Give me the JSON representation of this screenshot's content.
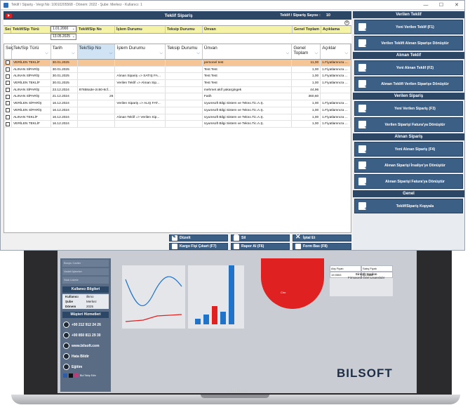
{
  "window": {
    "title": "Teklif / Sipariş - Vergi No: 10010205568 - Dönem: 2022 - Şube: Merkez - Kullanıcı: 1",
    "controls": [
      "—",
      "☐",
      "✕"
    ]
  },
  "header": {
    "title": "Teklif Sipariş",
    "count_label": "Teklif / Sipariş Sayısı :",
    "count_value": "10"
  },
  "filters": {
    "labels": [
      "Seç",
      "Teklif/Sip Türü",
      "",
      "Teklif/Sip No",
      "İşlem Durumu",
      "Teksip Durumu",
      "Ünvan",
      "Genel Toplam",
      "Açıklama"
    ],
    "date_from": "1.01.2000",
    "date_to": "13.05.2025"
  },
  "grid": {
    "columns": [
      "Seç",
      "Tek/Sip Türü",
      "Tarih",
      "Tek/Sip No",
      "İşlem Durumu",
      "Teksip Durumu",
      "Ünvan",
      "Genel Toplam",
      "Açıklar"
    ],
    "rows": [
      {
        "type": "VERİLEN TEKLİF",
        "date": "30.01.2025",
        "no": "",
        "status": "",
        "teksip": "",
        "title": "personel test",
        "total": "11,00",
        "desc": "1.Fiyatlamnıza ..."
      },
      {
        "type": "ALINAN SİPARİŞ",
        "date": "30.01.2025",
        "no": "",
        "status": "",
        "teksip": "",
        "title": "Test Test",
        "total": "1,00",
        "desc": "1.Fiyatlamnıza ..."
      },
      {
        "type": "ALINAN SİPARİŞ",
        "date": "30.01.2025",
        "no": "",
        "status": "Alınan Sipariş => SATIŞ FA...",
        "teksip": "",
        "title": "Test Test",
        "total": "1,00",
        "desc": "1.Fiyatlamnıza ..."
      },
      {
        "type": "VERİLEN TEKLİF",
        "date": "30.01.2025",
        "no": "",
        "status": "Verilen Teklif => Alınan Sip...",
        "teksip": "",
        "title": "Test Test",
        "total": "1,00",
        "desc": "1.Fiyatlamnıza ..."
      },
      {
        "type": "ALINAN SİPARİŞ",
        "date": "23.12.2024",
        "no": "87658a3e-2c60-8cf...",
        "status": "",
        "teksip": "",
        "title": "mehmet akif yakargingek",
        "total": "44,96",
        "desc": ""
      },
      {
        "type": "ALINAN SİPARİŞ",
        "date": "21.12.2024",
        "no": "26",
        "status": "",
        "teksip": "",
        "title": "Fatih",
        "total": "360,60",
        "desc": ""
      },
      {
        "type": "VERİLEN SİPARİŞ",
        "date": "16.12.2024",
        "no": "",
        "status": "Verilen Sipariş => ALIŞ FAT...",
        "teksip": "",
        "title": "Uyumsoft Bilgi Sistem ve Tekno.Tic.A.Ş.",
        "total": "1,00",
        "desc": "1.Fiyatlamnıza ..."
      },
      {
        "type": "VERİLEN SİPARİŞ",
        "date": "16.12.2024",
        "no": "",
        "status": "",
        "teksip": "",
        "title": "Uyumsoft Bilgi Sistem ve Tekno.Tic.A.Ş.",
        "total": "1,00",
        "desc": "1.Fiyatlamnıza ..."
      },
      {
        "type": "ALINAN TEKLİF",
        "date": "16.12.2024",
        "no": "",
        "status": "Alınan Teklif => Verilen Sip...",
        "teksip": "",
        "title": "Uyumsoft Bilgi Sistem ve Tekno.Tic.A.Ş.",
        "total": "1,00",
        "desc": "1.Fiyatlamnıza ..."
      },
      {
        "type": "VERİLEN TEKLİF",
        "date": "16.12.2024",
        "no": "",
        "status": "",
        "teksip": "",
        "title": "Uyumsoft Bilgi Sistem ve Tekno.Tic.A.Ş.",
        "total": "1,00",
        "desc": "1.Fiyatlamnıza ..."
      }
    ]
  },
  "actions": {
    "edit": "Düzelt",
    "delete": "Sil",
    "cancel": "İptal Et",
    "cargo": "Kargo Fişi Çıkart (F7)",
    "report": "Rapor Al (F6)",
    "print": "Form Bas (F8)"
  },
  "right_panel": {
    "sections": [
      {
        "title": "Verilen Teklif",
        "buttons": [
          "Yeni Verilen Teklif (F1)",
          "Verilen Teklifi Alınan Siparişe Dönüştür"
        ]
      },
      {
        "title": "Alınan Teklif",
        "buttons": [
          "Yeni Alınan Teklif (F2)",
          "Alınan Teklifi Verilen Siparişe Dönüştür"
        ]
      },
      {
        "title": "Verilen Sipariş",
        "buttons": [
          "Yeni Verilen Sipariş (F3)",
          "Verilen Siparişi Fatura'ya Dönüştür"
        ]
      },
      {
        "title": "Alınan Sipariş",
        "buttons": [
          "Yeni Alınan Sipariş (F4)",
          "Alınan Siparişi İrsaliye'ye Dönüştür",
          "Alınan Siparişi Fatura'ya Dönüştür"
        ]
      },
      {
        "title": "Genel",
        "buttons": [
          "Teklif/Sipariş Kopyala"
        ]
      }
    ]
  },
  "background_app": {
    "sidebar_items": [
      "Borçlu Cariler",
      "Vadeli İşlemler",
      "Stok Listele"
    ],
    "user_info_title": "Kullanıcı Bilgileri",
    "user_info": [
      {
        "k": "Kullanıcı",
        "v": "ilkmo"
      },
      {
        "k": "Şube",
        "v": "Merkez"
      },
      {
        "k": "Dönem",
        "v": "2025"
      }
    ],
    "support_title": "Müşteri Hizmetleri",
    "phone1": "+90 212 912 24 26",
    "phone2": "+90 850 811 29 30",
    "website": "www.bilsoft.com",
    "report_bug": "Hata Bildir",
    "tutorial": "Eğitim",
    "follow": "Bizi Takip Edin",
    "table_headers": [
      "Alış Fiyatı",
      "Satış Fiyatı"
    ],
    "table_values": [
      "19,9553",
      "26,9328"
    ],
    "firma_title": "Sirsoft Yazılım",
    "firma_sub": "Firmasına Özel Lisanslıdır",
    "pie_label": "Ciro",
    "brand": "BILSOFT",
    "device": "MacBook"
  }
}
